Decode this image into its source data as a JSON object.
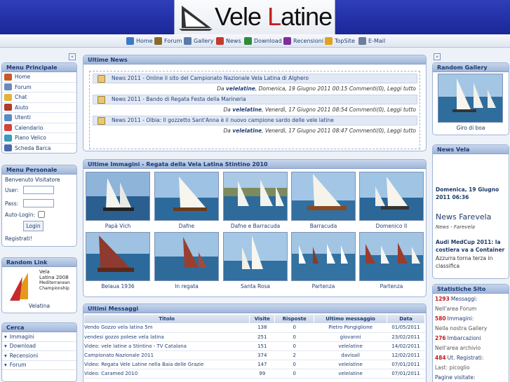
{
  "banner": {
    "logo_text_1": "Vele ",
    "logo_text_2": "L",
    "logo_text_3": "atine"
  },
  "nav": [
    {
      "label": "Home",
      "color": "#3c79c9"
    },
    {
      "label": "Forum",
      "color": "#8a6a2a"
    },
    {
      "label": "Gallery",
      "color": "#5a7aa8"
    },
    {
      "label": "News",
      "color": "#c33b2b"
    },
    {
      "label": "Download",
      "color": "#2f8a3a"
    },
    {
      "label": "Recensioni",
      "color": "#7d2e9a"
    },
    {
      "label": "TopSite",
      "color": "#e0a21c"
    },
    {
      "label": "E-Mail",
      "color": "#6a7f9e"
    }
  ],
  "left": {
    "menu_principale": {
      "title": "Menu Principale",
      "items": [
        "Home",
        "Forum",
        "Chat",
        "Aiuto",
        "Utenti",
        "Calendario",
        "Piano Velico",
        "Scheda Barca"
      ]
    },
    "menu_personale": {
      "title": "Menu Personale",
      "welcome": "Benvenuto Visitatore",
      "user_label": "User:",
      "pass_label": "Pass:",
      "autologin_label": "Auto-Login:",
      "login_button": "Login",
      "register": "Registrati!"
    },
    "random_link": {
      "title": "Random Link",
      "logo_line1": "Vela",
      "logo_line2": "Latina 2008",
      "logo_line3": "Mediterranean",
      "logo_line4": "Championship",
      "caption": "Velatina"
    },
    "cerca": {
      "title": "Cerca",
      "items": [
        "Immagini",
        "Download",
        "Recensioni",
        "Forum"
      ]
    }
  },
  "center": {
    "news": {
      "title": "Ultime News",
      "items": [
        {
          "headline": "News 2011 - Online il sito del Campionato Nazionale Vela Latina di Alghero",
          "da": "Da",
          "author": "velelatine",
          "date": ", Domenica, 19 Giugno 2011 00:15",
          "comments": "Commenti(0)",
          "read": "Leggi tutto"
        },
        {
          "headline": "News 2011 - Bando di Regata Festa della Marineria",
          "da": "Da",
          "author": "velelatine",
          "date": ", Venerdì, 17 Giugno 2011 08:54",
          "comments": "Commenti(0)",
          "read": "Leggi tutto"
        },
        {
          "headline": "News 2011 - Olbia: Il gozzetto Sant'Anna è il nuovo campione sardo delle vele latine",
          "da": "Da",
          "author": "velelatine",
          "date": ", Venerdì, 17 Giugno 2011 08:47",
          "comments": "Commenti(0)",
          "read": "Leggi tutto"
        }
      ]
    },
    "images": {
      "title": "Ultime Immagini - Regata della Vela Latina Stintino 2010",
      "captions": [
        "Papà Vich",
        "Dafne",
        "Dafne e Barracuda",
        "Barracuda",
        "Domenico II",
        "Belaua 1936",
        "In regata",
        "Santa Rosa",
        "Partenza",
        "Partenza"
      ]
    },
    "messages": {
      "title": "Ultimi Messaggi",
      "headers": [
        "Titolo",
        "Visite",
        "Risposte",
        "Ultimo messaggio",
        "Data"
      ],
      "rows": [
        [
          "Vendo Gozzo vela latina 5m",
          "138",
          "0",
          "Pietro Pongiglione",
          "01/05/2011"
        ],
        [
          "vendesi gozzo polese vela latina",
          "251",
          "0",
          "giovanni",
          "23/02/2011"
        ],
        [
          "Video: vele latine a Stintino - TV Catalana",
          "151",
          "0",
          "velelatine",
          "14/02/2011"
        ],
        [
          "Campionato Nazionale 2011",
          "374",
          "2",
          "davisail",
          "12/02/2011"
        ],
        [
          "Video: Regata Vele Latine nella Baia delle Grazie",
          "147",
          "0",
          "velelatine",
          "07/01/2011"
        ],
        [
          "Video: Caramed 2010",
          "99",
          "0",
          "velelatine",
          "07/01/2011"
        ]
      ]
    }
  },
  "right": {
    "random_gallery": {
      "title": "Random Gallery",
      "caption": "Giro di boa"
    },
    "news_vela": {
      "title": "News Vela",
      "date": "Domenica, 19 Giugno 2011 06:36",
      "source_title": "News Farevela",
      "source_sub": "News - Farevela",
      "item_title": "Audi MedCup 2011: la costiera va a Container",
      "item_text": "Azzurra torna terza in classifica"
    },
    "stats": {
      "title": "Statistiche Sito",
      "rows": [
        {
          "num": "1293",
          "label": "Messaggi:",
          "sub": "Nell'area Forum"
        },
        {
          "num": "580",
          "label": "Immagini:",
          "sub": "Nella nostra Gallery"
        },
        {
          "num": "276",
          "label": "Imbarcazioni",
          "sub": "Nell'area archivio"
        },
        {
          "num": "484",
          "label": "Ut. Registrati:",
          "sub": "Last: picoglio"
        }
      ],
      "pages_label": "Pagine visitate:"
    }
  }
}
